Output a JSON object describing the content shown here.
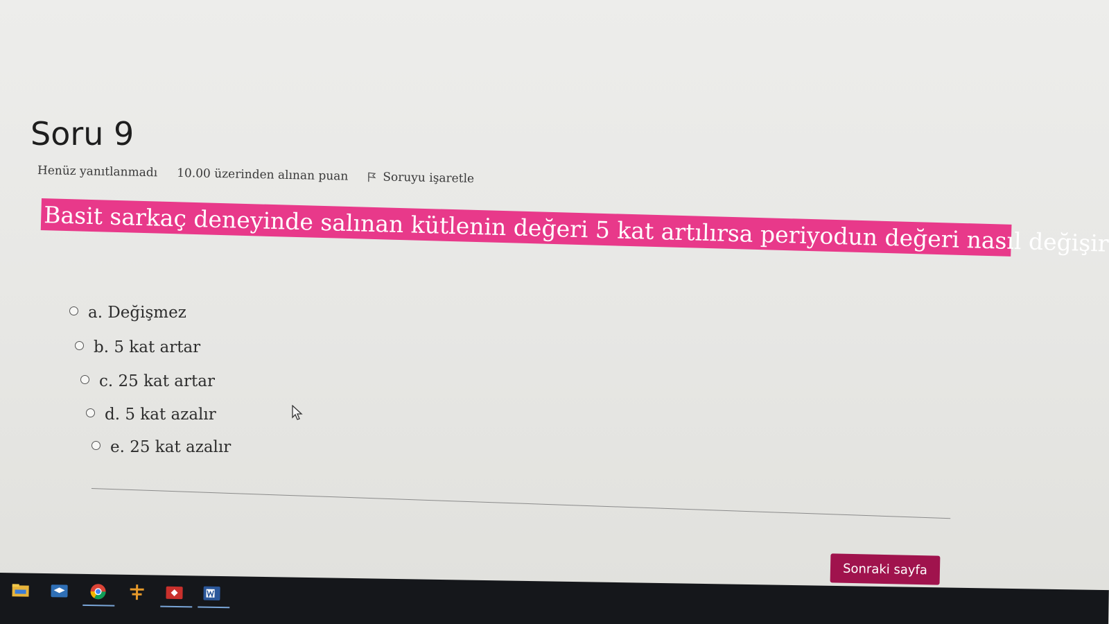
{
  "question": {
    "title": "Soru 9",
    "state": "Henüz yanıtlanmadı",
    "grade": "10.00 üzerinden alınan puan",
    "flag_label": "Soruyu işaretle",
    "text": "Basit sarkaç deneyinde salınan kütlenin değeri 5 kat artılırsa periyodun değeri nasıl değişir?",
    "highlight_color": "#e8398a"
  },
  "options": [
    {
      "label": "a. Değişmez",
      "selected": false
    },
    {
      "label": "b. 5 kat artar",
      "selected": false
    },
    {
      "label": "c. 25 kat artar",
      "selected": false
    },
    {
      "label": "d. 5 kat azalır",
      "selected": false
    },
    {
      "label": "e. 25 kat azalır",
      "selected": false
    }
  ],
  "navigation": {
    "next_label": "Sonraki sayfa",
    "button_color": "#a0134d"
  },
  "taskbar": {
    "apps": [
      "file-explorer-icon",
      "store-icon",
      "chrome-icon",
      "app-icon",
      "media-icon",
      "word-icon"
    ]
  }
}
